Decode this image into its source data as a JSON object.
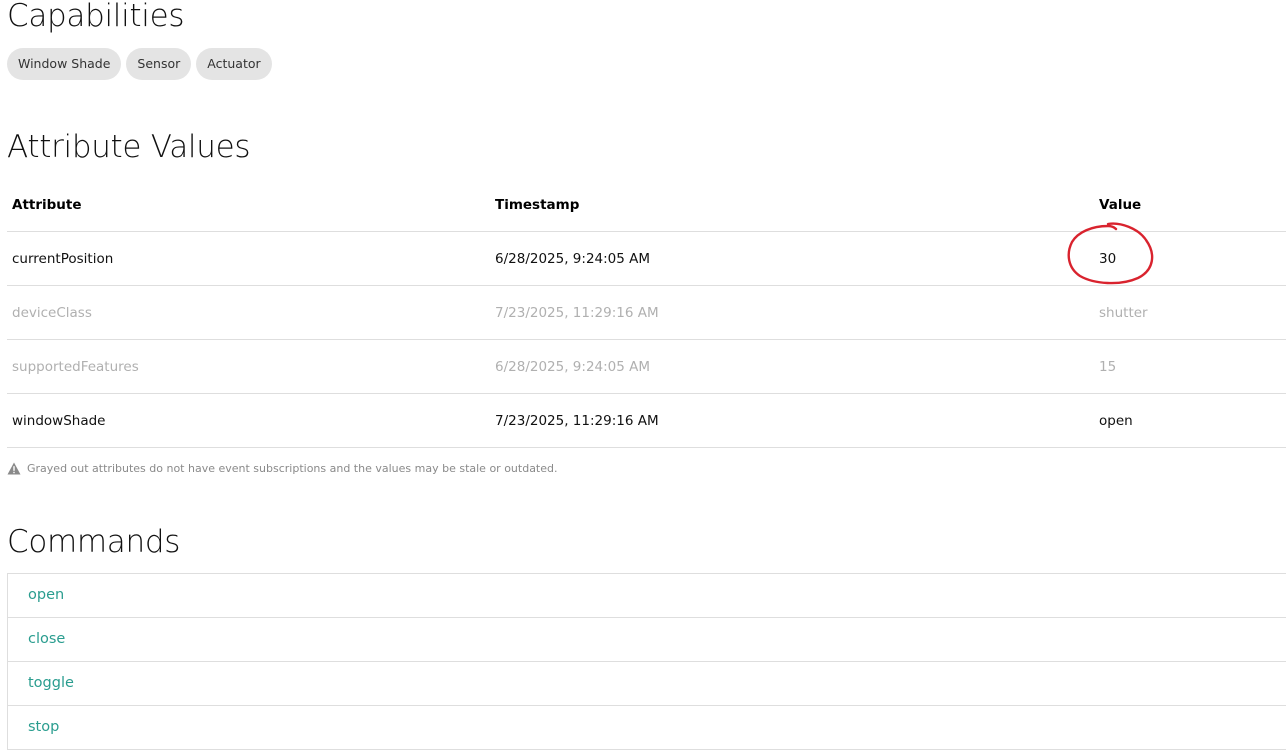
{
  "capabilities": {
    "title": "Capabilities",
    "chips": [
      "Window Shade",
      "Sensor",
      "Actuator"
    ]
  },
  "attributes": {
    "title": "Attribute Values",
    "headers": {
      "attribute": "Attribute",
      "timestamp": "Timestamp",
      "value": "Value"
    },
    "rows": [
      {
        "attribute": "currentPosition",
        "timestamp": "6/28/2025, 9:24:05 AM",
        "value": "30",
        "stale": false
      },
      {
        "attribute": "deviceClass",
        "timestamp": "7/23/2025, 11:29:16 AM",
        "value": "shutter",
        "stale": true
      },
      {
        "attribute": "supportedFeatures",
        "timestamp": "6/28/2025, 9:24:05 AM",
        "value": "15",
        "stale": true
      },
      {
        "attribute": "windowShade",
        "timestamp": "7/23/2025, 11:29:16 AM",
        "value": "open",
        "stale": false
      }
    ],
    "note": "Grayed out attributes do not have event subscriptions and the values may be stale or outdated.",
    "note_icon": "warning-icon"
  },
  "commands": {
    "title": "Commands",
    "items": [
      "open",
      "close",
      "toggle",
      "stop"
    ]
  },
  "colors": {
    "command_link": "#2a9d8f",
    "stale_text": "#b0b0b0",
    "annotation": "#d9232e",
    "chip_bg": "#e4e4e4"
  }
}
